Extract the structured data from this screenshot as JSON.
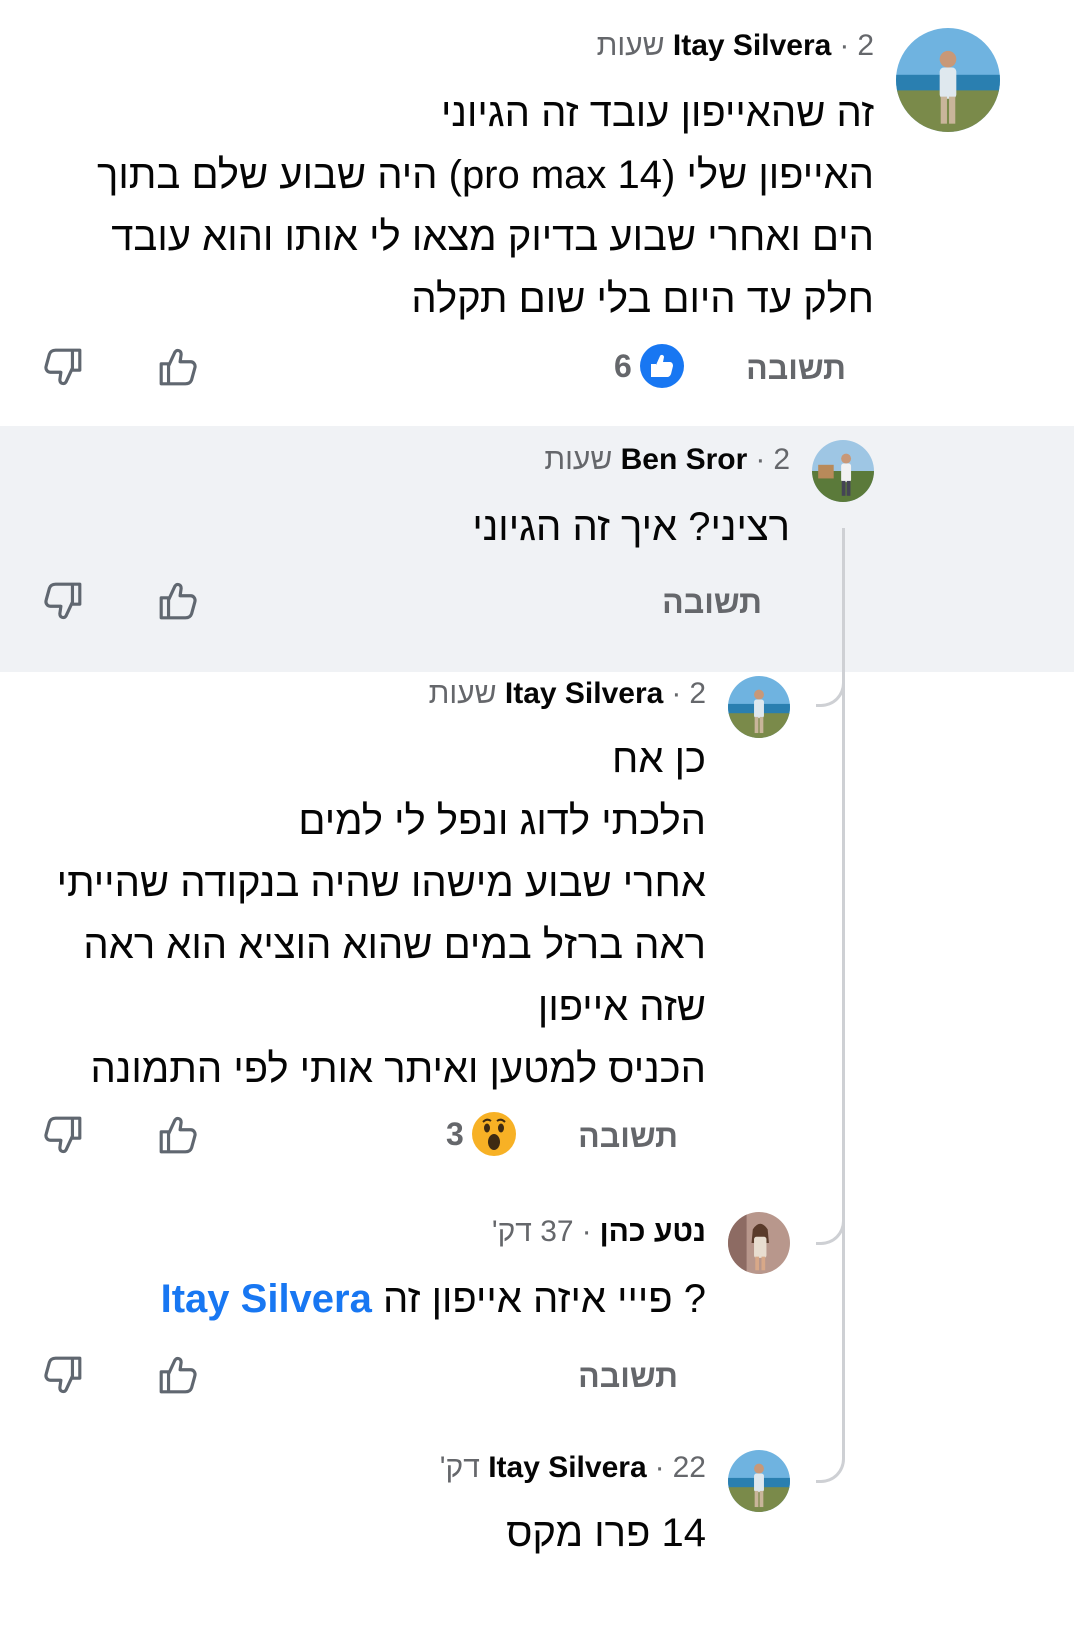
{
  "reply_label": "תשובה",
  "accent_color": "#1877f2",
  "comments": [
    {
      "author": "Itay Silvera",
      "time": "2 שעות",
      "lines": [
        "זה שהאייפון עובד זה הגיוני",
        "האייפון שלי (pro max 14) היה שבוע שלם בתוך",
        "הים ואחרי שבוע בדיוק מצאו לי אותו והוא עובד",
        "חלק עד היום בלי שום תקלה"
      ],
      "reaction_count": "6",
      "reaction_icon": "like-icon"
    },
    {
      "author": "Ben Sror",
      "time": "2 שעות",
      "lines": [
        "רציני? איך זה הגיוני"
      ]
    },
    {
      "author": "Itay Silvera",
      "time": "2 שעות",
      "lines": [
        "כן אח",
        "הלכתי לדוג ונפל לי למים",
        "אחרי שבוע מישהו שהיה בנקודה שהייתי",
        "ראה ברזל במים שהוא הוציא הוא ראה",
        "שזה אייפון",
        "הכניס למטען ואיתר אותי לפי התמונה"
      ],
      "reaction_count": "3",
      "reaction_icon": "wow-icon"
    },
    {
      "author": "נטע כהן",
      "time": "37 דק'",
      "text": "? פייי איזה אייפון זה",
      "mention": "Itay Silvera"
    },
    {
      "author": "Itay Silvera",
      "time": "22 דק'",
      "lines": [
        "14 פרו מקס"
      ]
    }
  ]
}
